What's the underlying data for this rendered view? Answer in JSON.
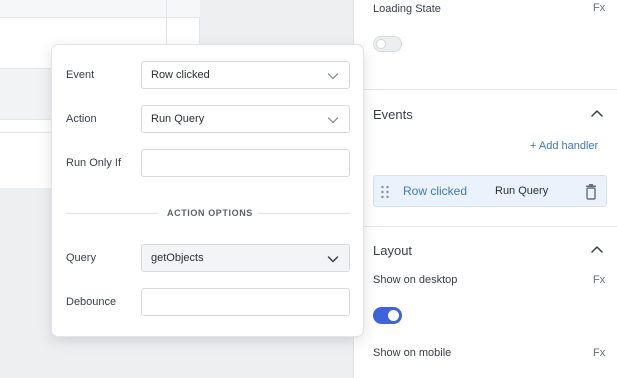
{
  "popover": {
    "event": {
      "label": "Event",
      "value": "Row clicked"
    },
    "action": {
      "label": "Action",
      "value": "Run Query"
    },
    "run_only_if": {
      "label": "Run Only If",
      "value": ""
    },
    "options_title": "ACTION OPTIONS",
    "query": {
      "label": "Query",
      "value": "getObjects"
    },
    "debounce": {
      "label": "Debounce",
      "value": ""
    }
  },
  "panel": {
    "loading_state": {
      "label": "Loading State",
      "fx": "Fx",
      "toggle_on": false
    },
    "events": {
      "title": "Events",
      "add_handler": "+ Add handler",
      "handlers": [
        {
          "event": "Row clicked",
          "action": "Run Query"
        }
      ]
    },
    "layout": {
      "title": "Layout",
      "show_on_desktop": {
        "label": "Show on desktop",
        "fx": "Fx",
        "toggle_on": true
      },
      "show_on_mobile": {
        "label": "Show on mobile",
        "fx": "Fx"
      }
    }
  },
  "icons": {
    "chevron_up": "chevron-up-icon",
    "chevron_down": "chevron-down-icon",
    "drag": "drag-handle-icon",
    "trash": "trash-icon"
  },
  "colors": {
    "accent": "#3e63dd",
    "link": "#3e7bb6",
    "handler_bg": "#eaf2fb"
  }
}
